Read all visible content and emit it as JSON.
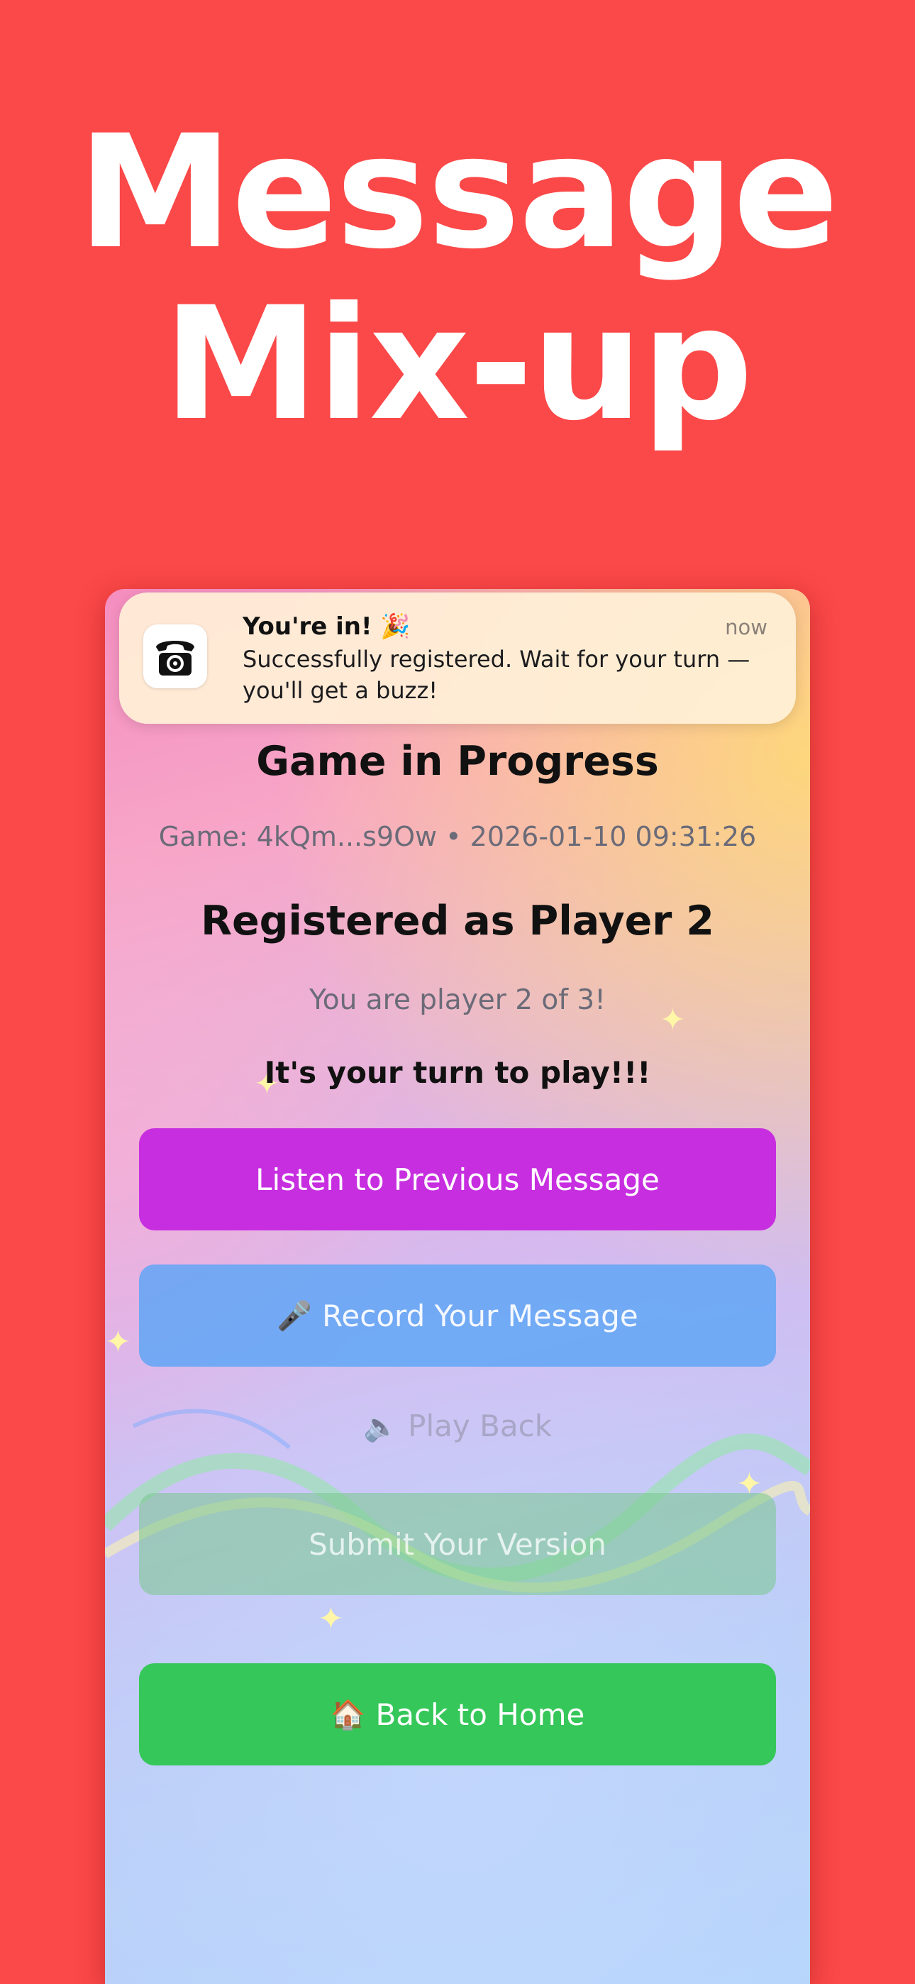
{
  "hero": {
    "line1": "Message",
    "line2": "Mix-up"
  },
  "notification": {
    "title": "You're in! 🎉",
    "time": "now",
    "body": "Successfully registered. Wait for your turn — you'll get a buzz!",
    "app_icon": "telephone-icon"
  },
  "game": {
    "title": "Game in Progress",
    "meta": "Game: 4kQm...s9Ow • 2026-01-10 09:31:26",
    "registered": "Registered as Player 2",
    "player_info": "You are player 2 of 3!",
    "turn_text": "It's your turn to play!!!"
  },
  "buttons": {
    "listen": "Listen to Previous Message",
    "record_icon": "🎤",
    "record": "Record Your Message",
    "playback_icon": "🔈",
    "playback": "Play Back",
    "submit": "Submit Your Version",
    "home_icon": "🏠",
    "home": "Back to Home"
  },
  "colors": {
    "background": "#fb4848",
    "listen_button": "#c72ee0",
    "record_button": "#5ca5f5",
    "home_button": "#35c759"
  }
}
